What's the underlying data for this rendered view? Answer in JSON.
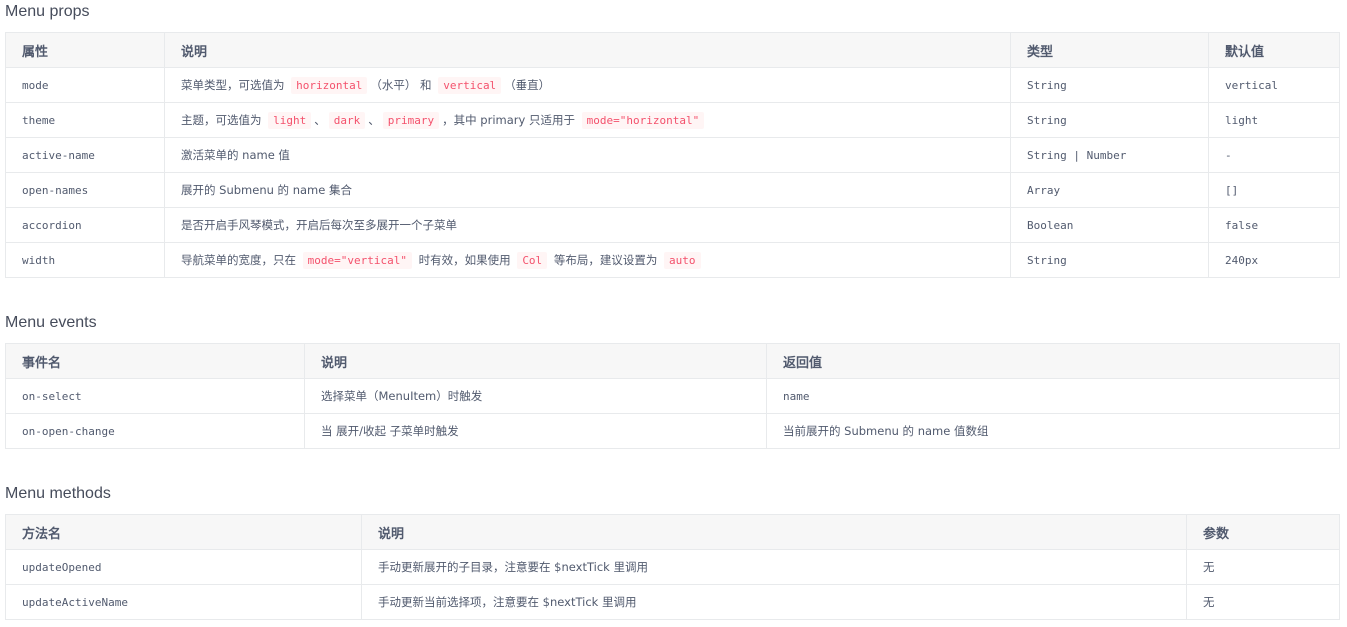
{
  "props": {
    "title": "Menu props",
    "headers": [
      "属性",
      "说明",
      "类型",
      "默认值"
    ],
    "rows": [
      {
        "name": "mode",
        "desc": [
          {
            "t": "菜单类型，可选值为 "
          },
          {
            "c": "horizontal"
          },
          {
            "t": "（水平） 和 "
          },
          {
            "c": "vertical"
          },
          {
            "t": "（垂直）"
          }
        ],
        "type": "String",
        "default": "vertical"
      },
      {
        "name": "theme",
        "desc": [
          {
            "t": "主题，可选值为 "
          },
          {
            "c": "light"
          },
          {
            "t": "、"
          },
          {
            "c": "dark"
          },
          {
            "t": "、"
          },
          {
            "c": "primary"
          },
          {
            "t": "，其中 primary 只适用于 "
          },
          {
            "c": "mode=\"horizontal\""
          }
        ],
        "type": "String",
        "default": "light"
      },
      {
        "name": "active-name",
        "desc": [
          {
            "t": "激活菜单的 name 值"
          }
        ],
        "type": "String | Number",
        "default": "-"
      },
      {
        "name": "open-names",
        "desc": [
          {
            "t": "展开的 Submenu 的 name 集合"
          }
        ],
        "type": "Array",
        "default": "[]"
      },
      {
        "name": "accordion",
        "desc": [
          {
            "t": "是否开启手风琴模式，开启后每次至多展开一个子菜单"
          }
        ],
        "type": "Boolean",
        "default": "false"
      },
      {
        "name": "width",
        "desc": [
          {
            "t": "导航菜单的宽度，只在 "
          },
          {
            "c": "mode=\"vertical\""
          },
          {
            "t": " 时有效，如果使用 "
          },
          {
            "c": "Col"
          },
          {
            "t": " 等布局，建议设置为 "
          },
          {
            "c": "auto"
          }
        ],
        "type": "String",
        "default": "240px"
      }
    ]
  },
  "events": {
    "title": "Menu events",
    "headers": [
      "事件名",
      "说明",
      "返回值"
    ],
    "rows": [
      {
        "name": "on-select",
        "desc": "选择菜单（MenuItem）时触发",
        "ret": "name"
      },
      {
        "name": "on-open-change",
        "desc": "当 展开/收起 子菜单时触发",
        "ret": "当前展开的 Submenu 的 name 值数组"
      }
    ]
  },
  "methods": {
    "title": "Menu methods",
    "headers": [
      "方法名",
      "说明",
      "参数"
    ],
    "rows": [
      {
        "name": "updateOpened",
        "desc": "手动更新展开的子目录，注意要在 $nextTick 里调用",
        "param": "无"
      },
      {
        "name": "updateActiveName",
        "desc": "手动更新当前选择项，注意要在 $nextTick 里调用",
        "param": "无"
      }
    ]
  }
}
